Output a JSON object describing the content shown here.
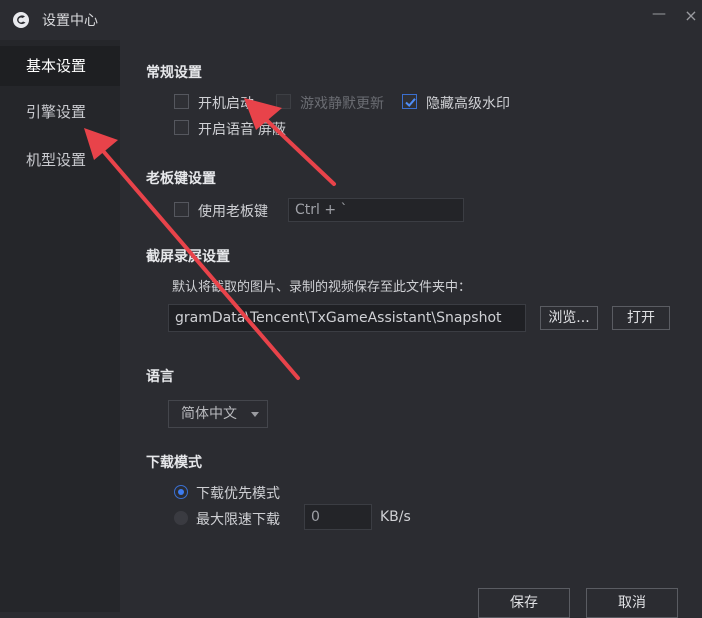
{
  "window": {
    "title": "设置中心",
    "min_symbol": "—",
    "close_symbol": "×"
  },
  "sidebar": {
    "items": [
      {
        "label": "基本设置",
        "active": true
      },
      {
        "label": "引擎设置",
        "active": false
      },
      {
        "label": "机型设置",
        "active": false
      }
    ]
  },
  "general": {
    "title": "常规设置",
    "autostart_label": "开机启动",
    "autostart_checked": false,
    "silent_update_label": "游戏静默更新",
    "silent_update_checked": false,
    "silent_update_disabled": true,
    "hide_watermark_label": "隐藏高级水印",
    "hide_watermark_checked": true,
    "voice_label": "开启语音",
    "voice_suffix": "屏蔽",
    "voice_checked": false
  },
  "bosskey": {
    "title": "老板键设置",
    "enable_label": "使用老板键",
    "enabled": false,
    "hotkey_value": "Ctrl + `"
  },
  "screenshot": {
    "title": "截屏录屏设置",
    "description": "默认将截取的图片、录制的视频保存至此文件夹中：",
    "path_value": "gramData\\Tencent\\TxGameAssistant\\Snapshot",
    "browse_label": "浏览...",
    "open_label": "打开"
  },
  "language": {
    "title": "语言",
    "selected": "简体中文"
  },
  "download": {
    "title": "下载模式",
    "priority_label": "下载优先模式",
    "priority_selected": true,
    "limit_label": "最大限速下载",
    "limit_selected": false,
    "limit_value": "0",
    "limit_unit": "KB/s"
  },
  "footer": {
    "save_label": "保存",
    "cancel_label": "取消"
  },
  "colors": {
    "accent": "#3d7cf0",
    "annotation_arrow": "#e8434a",
    "background": "#2b2c31",
    "sidebar": "#25262a"
  }
}
